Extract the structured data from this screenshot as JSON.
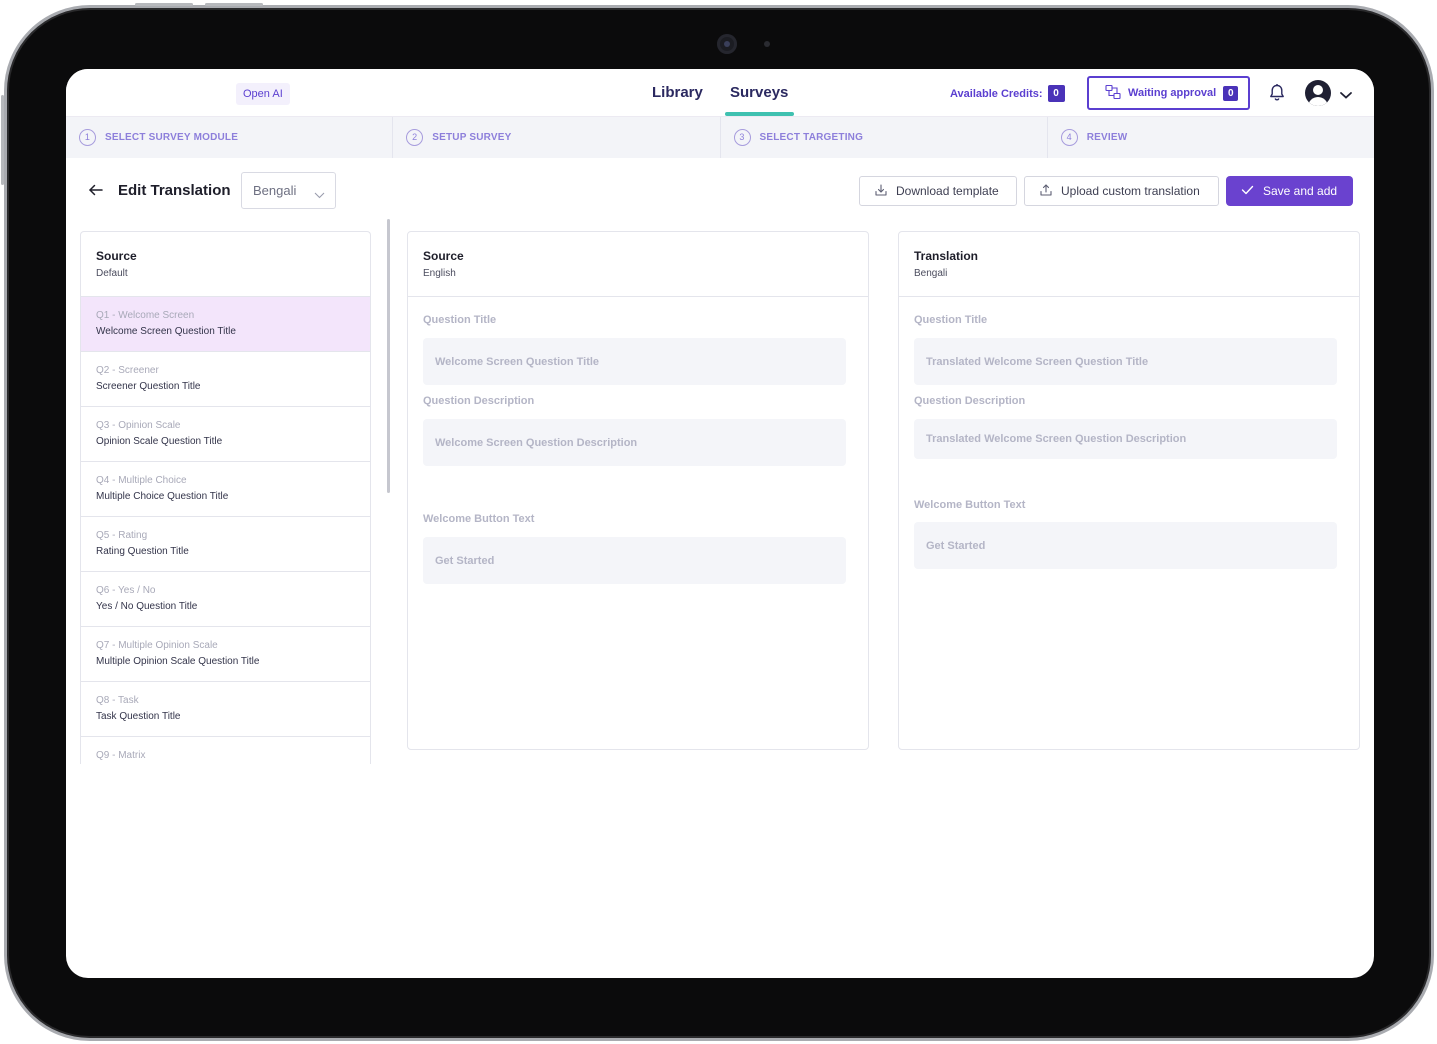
{
  "brand": {
    "label": "Open AI"
  },
  "nav": {
    "library": "Library",
    "surveys": "Surveys"
  },
  "header": {
    "credits_label": "Available Credits:",
    "credits_value": "0",
    "waiting_label": "Waiting approval",
    "waiting_count": "0"
  },
  "stepper": [
    {
      "num": "1",
      "label": "SELECT SURVEY MODULE"
    },
    {
      "num": "2",
      "label": "SETUP SURVEY"
    },
    {
      "num": "3",
      "label": "SELECT TARGETING"
    },
    {
      "num": "4",
      "label": "REVIEW"
    }
  ],
  "toolbar": {
    "title": "Edit Translation",
    "language": "Bengali",
    "download": "Download template",
    "upload": "Upload custom translation",
    "save": "Save and add"
  },
  "question_list": {
    "header": {
      "title": "Source",
      "subtitle": "Default"
    },
    "items": [
      {
        "type": "Q1 - Welcome Screen",
        "title": "Welcome Screen Question Title",
        "active": true
      },
      {
        "type": "Q2 - Screener",
        "title": "Screener Question Title"
      },
      {
        "type": "Q3 - Opinion Scale",
        "title": "Opinion Scale Question Title"
      },
      {
        "type": "Q4 - Multiple Choice",
        "title": "Multiple Choice Question Title"
      },
      {
        "type": "Q5 - Rating",
        "title": "Rating Question Title"
      },
      {
        "type": "Q6 - Yes / No",
        "title": "Yes / No Question Title"
      },
      {
        "type": "Q7 - Multiple Opinion Scale",
        "title": "Multiple Opinion Scale Question Title"
      },
      {
        "type": "Q8 - Task",
        "title": "Task Question Title"
      },
      {
        "type": "Q9 - Matrix",
        "title": ""
      }
    ]
  },
  "source_panel": {
    "title": "Source",
    "subtitle": "English",
    "question_title_label": "Question Title",
    "question_title_value": "Welcome Screen Question Title",
    "question_desc_label": "Question Description",
    "question_desc_value": "Welcome Screen Question Description",
    "button_label": "Welcome Button Text",
    "button_value": "Get Started"
  },
  "translation_panel": {
    "title": "Translation",
    "subtitle": "Bengali",
    "question_title_label": "Question Title",
    "question_title_value": "Translated Welcome Screen Question Title",
    "question_desc_label": "Question Description",
    "question_desc_value": "Translated Welcome Screen Question Description",
    "button_label": "Welcome Button Text",
    "button_value": "Get Started"
  },
  "colors": {
    "accent": "#6a42cf",
    "active_row": "#f3e5fb",
    "tab_indicator": "#3fc1b0"
  }
}
